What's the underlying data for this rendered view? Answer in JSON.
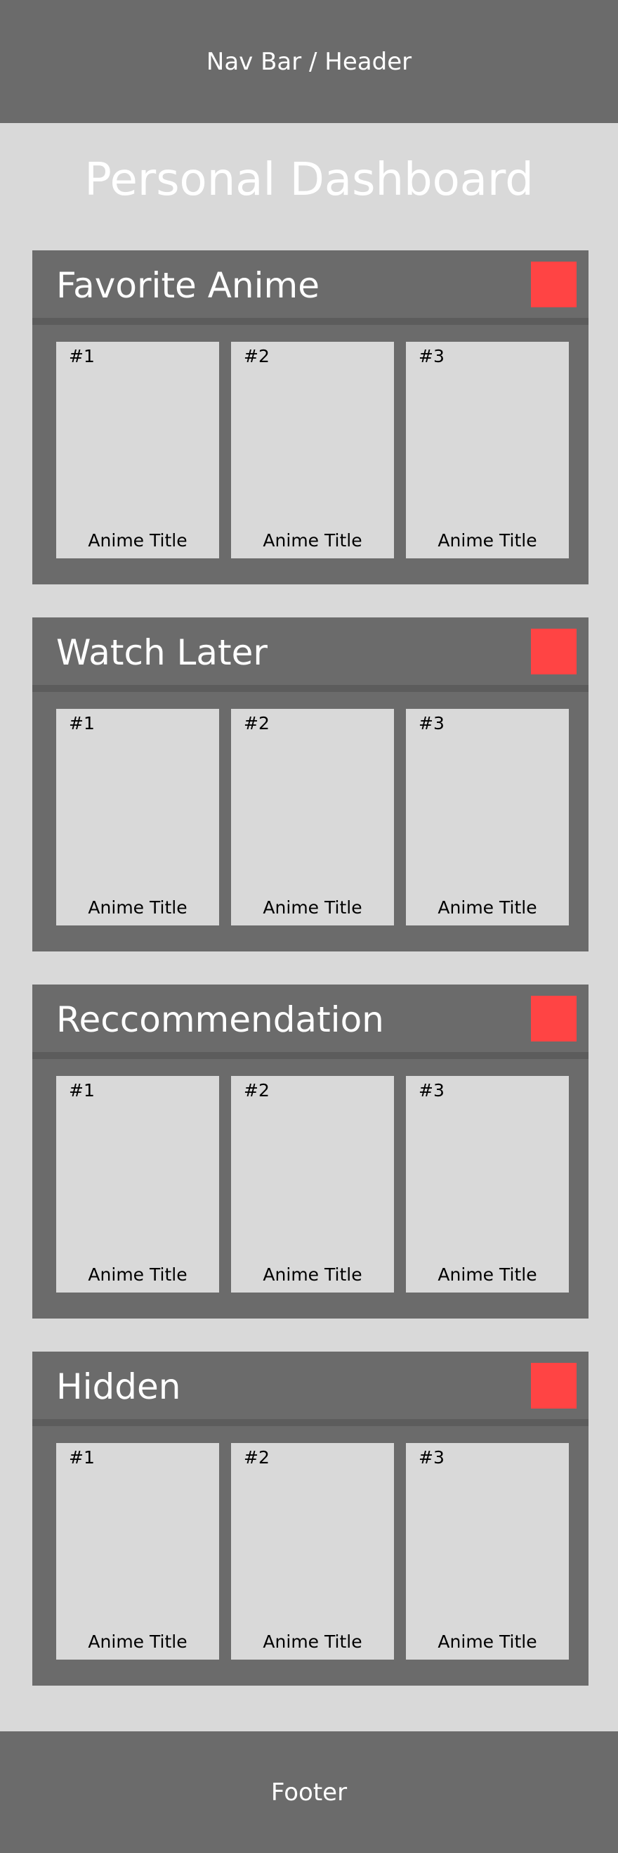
{
  "header": {
    "label": "Nav Bar / Header"
  },
  "page": {
    "title": "Personal Dashboard"
  },
  "sections": [
    {
      "title": "Favorite Anime",
      "cards": [
        {
          "rank": "#1",
          "title": "Anime Title"
        },
        {
          "rank": "#2",
          "title": "Anime Title"
        },
        {
          "rank": "#3",
          "title": "Anime Title"
        }
      ]
    },
    {
      "title": "Watch Later",
      "cards": [
        {
          "rank": "#1",
          "title": "Anime Title"
        },
        {
          "rank": "#2",
          "title": "Anime Title"
        },
        {
          "rank": "#3",
          "title": "Anime Title"
        }
      ]
    },
    {
      "title": "Reccommendation",
      "cards": [
        {
          "rank": "#1",
          "title": "Anime Title"
        },
        {
          "rank": "#2",
          "title": "Anime Title"
        },
        {
          "rank": "#3",
          "title": "Anime Title"
        }
      ]
    },
    {
      "title": "Hidden",
      "cards": [
        {
          "rank": "#1",
          "title": "Anime Title"
        },
        {
          "rank": "#2",
          "title": "Anime Title"
        },
        {
          "rank": "#3",
          "title": "Anime Title"
        }
      ]
    }
  ],
  "footer": {
    "label": "Footer"
  },
  "colors": {
    "panel": "#6b6b6b",
    "background": "#d9d9d9",
    "divider": "#5c5c5c",
    "accent": "#ff4444"
  }
}
